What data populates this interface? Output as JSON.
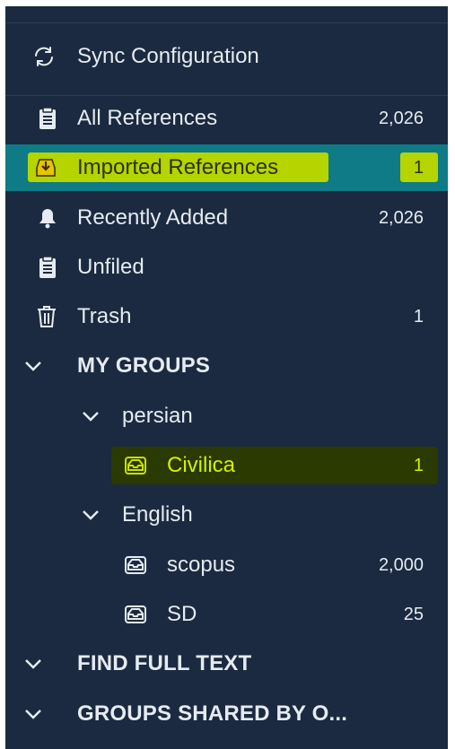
{
  "sync": {
    "label": "Sync Configuration"
  },
  "library": [
    {
      "label": "All References",
      "count": "2,026",
      "icon": "clipboard-icon"
    },
    {
      "label": "Imported References",
      "count": "1",
      "icon": "import-tray-icon"
    },
    {
      "label": "Recently Added",
      "count": "2,026",
      "icon": "bell-icon"
    },
    {
      "label": "Unfiled",
      "count": "",
      "icon": "clipboard-icon"
    },
    {
      "label": "Trash",
      "count": "1",
      "icon": "trash-icon"
    }
  ],
  "my_groups": {
    "label": "MY GROUPS",
    "sets": [
      {
        "label": "persian",
        "groups": [
          {
            "label": "Civilica",
            "count": "1"
          }
        ]
      },
      {
        "label": "English",
        "groups": [
          {
            "label": "scopus",
            "count": "2,000"
          },
          {
            "label": "SD",
            "count": "25"
          }
        ]
      }
    ]
  },
  "find_full_text": {
    "label": "FIND FULL TEXT"
  },
  "shared_groups": {
    "label": "GROUPS SHARED BY O..."
  },
  "colors": {
    "sidebar_bg": "#1b2a40",
    "selected_bg": "#0f7b86",
    "highlight": "#b5d400",
    "highlight_dark": "#2a3a00",
    "text": "#e6ebf2"
  }
}
